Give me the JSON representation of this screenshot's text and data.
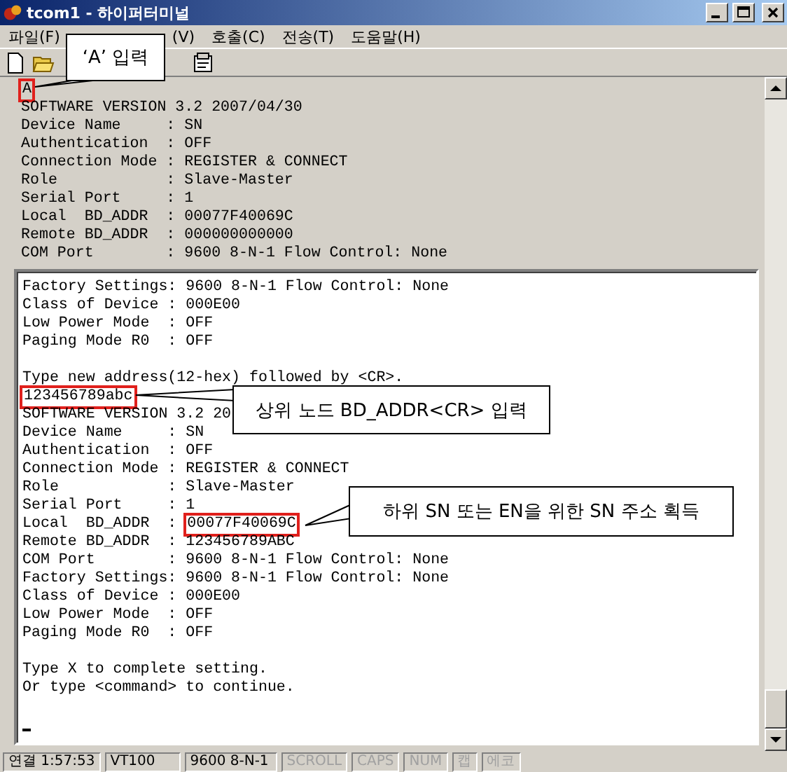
{
  "window": {
    "title": "tcom1 - 하이퍼터미널"
  },
  "menu": [
    "파일(F)",
    "(V)",
    "호출(C)",
    "전송(T)",
    "도움말(H)"
  ],
  "terminal": {
    "upper_lines": [
      {
        "kind": "text",
        "text": "A",
        "boxed": true
      },
      {
        "kind": "text",
        "text": "SOFTWARE VERSION 3.2 2007/04/30",
        "boxed": false
      },
      {
        "kind": "text",
        "text": "Device Name     : SN",
        "boxed": false
      },
      {
        "kind": "text",
        "text": "Authentication  : OFF",
        "boxed": false
      },
      {
        "kind": "text",
        "text": "Connection Mode : REGISTER & CONNECT",
        "boxed": false
      },
      {
        "kind": "text",
        "text": "Role            : Slave-Master",
        "boxed": false
      },
      {
        "kind": "text",
        "text": "Serial Port     : 1",
        "boxed": false
      },
      {
        "kind": "text",
        "text": "Local  BD_ADDR  : 00077F40069C",
        "boxed": false
      },
      {
        "kind": "text",
        "text": "Remote BD_ADDR  : 000000000000",
        "boxed": false
      },
      {
        "kind": "text",
        "text": "COM Port        : 9600 8-N-1 Flow Control: None",
        "boxed": false
      }
    ],
    "lines": [
      {
        "kind": "text",
        "text": "Factory Settings: 9600 8-N-1 Flow Control: None",
        "boxed": false
      },
      {
        "kind": "text",
        "text": "Class of Device : 000E00",
        "boxed": false
      },
      {
        "kind": "text",
        "text": "Low Power Mode  : OFF",
        "boxed": false
      },
      {
        "kind": "text",
        "text": "Paging Mode R0  : OFF",
        "boxed": false
      },
      {
        "kind": "blank"
      },
      {
        "kind": "text",
        "text": "Type new address(12-hex) followed by <CR>.",
        "boxed": false
      },
      {
        "kind": "text",
        "text": "123456789abc",
        "boxed": true
      },
      {
        "kind": "text",
        "text": "SOFTWARE VERSION 3.2 20",
        "boxed": false
      },
      {
        "kind": "text",
        "text": "Device Name     : SN",
        "boxed": false
      },
      {
        "kind": "text",
        "text": "Authentication  : OFF",
        "boxed": false
      },
      {
        "kind": "text",
        "text": "Connection Mode : REGISTER & CONNECT",
        "boxed": false
      },
      {
        "kind": "text",
        "text": "Role            : Slave-Master",
        "boxed": false
      },
      {
        "kind": "text",
        "text": "Serial Port     : 1",
        "boxed": false
      },
      {
        "kind": "text",
        "prefix": "Local  BD_ADDR  : ",
        "text": "00077F40069C",
        "boxed": true
      },
      {
        "kind": "text",
        "text": "Remote BD_ADDR  : 123456789ABC",
        "boxed": false
      },
      {
        "kind": "text",
        "text": "COM Port        : 9600 8-N-1 Flow Control: None",
        "boxed": false
      },
      {
        "kind": "text",
        "text": "Factory Settings: 9600 8-N-1 Flow Control: None",
        "boxed": false
      },
      {
        "kind": "text",
        "text": "Class of Device : 000E00",
        "boxed": false
      },
      {
        "kind": "text",
        "text": "Low Power Mode  : OFF",
        "boxed": false
      },
      {
        "kind": "text",
        "text": "Paging Mode R0  : OFF",
        "boxed": false
      },
      {
        "kind": "blank"
      },
      {
        "kind": "text",
        "text": "Type X to complete setting.",
        "boxed": false
      },
      {
        "kind": "text",
        "text": "Or type <command> to continue.",
        "boxed": false
      },
      {
        "kind": "blank"
      },
      {
        "kind": "cursor"
      }
    ]
  },
  "status_bar": [
    {
      "text": "연결 1:57:53",
      "disabled": false
    },
    {
      "text": "VT100",
      "disabled": false
    },
    {
      "text": "9600 8-N-1",
      "disabled": false
    },
    {
      "text": "SCROLL",
      "disabled": true
    },
    {
      "text": "CAPS",
      "disabled": true
    },
    {
      "text": "NUM",
      "disabled": true
    },
    {
      "text": "캡",
      "disabled": true
    },
    {
      "text": "에코",
      "disabled": true
    }
  ],
  "annotations": [
    {
      "text": "‘A’ 입력"
    },
    {
      "text": "상위 노드 BD_ADDR<CR> 입력"
    },
    {
      "text": "하위 SN 또는 EN을 위한 SN 주소 획득"
    }
  ]
}
